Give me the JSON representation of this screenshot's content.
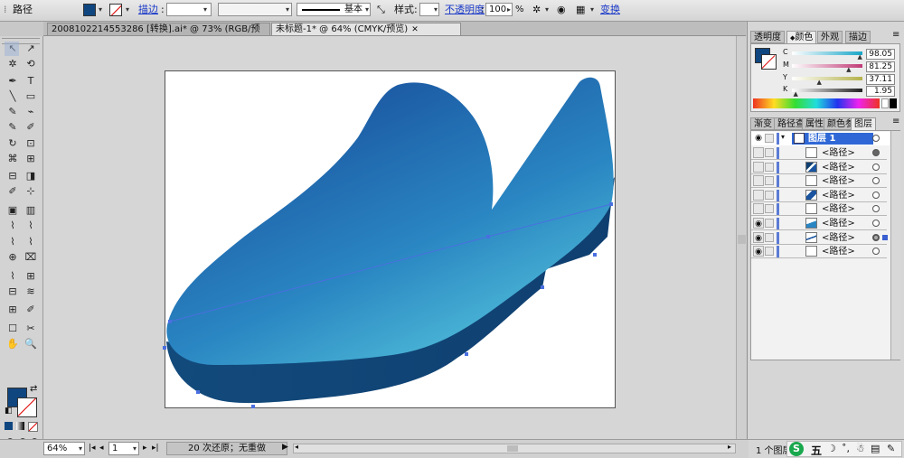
{
  "control_bar": {
    "selection_label": "路径",
    "fill_color": "#0f4680",
    "stroke_label": "描边",
    "stroke_weight": "",
    "brush_label": "基本",
    "style_label": "样式",
    "opacity_label": "不透明度",
    "opacity_value": "100",
    "opacity_unit": "%",
    "transform_label": "变换"
  },
  "tabs": [
    {
      "label": "2008102214553286 [转换].ai* @ 73% (RGB/预览)",
      "close": "✕"
    },
    {
      "label": "未标题-1* @ 64% (CMYK/预览)",
      "close": "✕"
    }
  ],
  "tools": [
    "↖",
    "↗",
    "✲",
    "⟲",
    "✒",
    "T",
    "╲",
    "▭",
    "✎",
    "⌁",
    "✎",
    "✐",
    "↻",
    "⊡",
    "⌘",
    "⊞",
    "⊟",
    "◨",
    "✐",
    "⊹",
    "▣",
    "▥",
    "⌇",
    "⌇",
    "⌇",
    "⌇",
    "⊕",
    "⌧",
    "⌇",
    "⊞",
    "⊟",
    "≋",
    "⊞",
    "✐",
    "☐",
    "✂",
    "✋",
    "🔍"
  ],
  "color_panel": {
    "tabs": [
      "透明度",
      "颜色",
      "外观",
      "描边"
    ],
    "active_tab": "颜色",
    "channels": [
      {
        "name": "C",
        "value": "98.05",
        "color": "#19a6c8"
      },
      {
        "name": "M",
        "value": "81.25",
        "color": "#c03a76"
      },
      {
        "name": "Y",
        "value": "37.11",
        "color": "#b4b24a"
      },
      {
        "name": "K",
        "value": "1.95",
        "color": "#202020"
      }
    ]
  },
  "layers_panel": {
    "tabs": [
      "渐变",
      "路径查",
      "属性",
      "颜色参",
      "图层"
    ],
    "active_tab": "图层",
    "parent_layer": "图层 1",
    "items": [
      {
        "label": "<路径>",
        "eye": false,
        "thumb": "blank"
      },
      {
        "label": "<路径>",
        "eye": false,
        "thumb": "dark"
      },
      {
        "label": "<路径>",
        "eye": false,
        "thumb": "blank"
      },
      {
        "label": "<路径>",
        "eye": false,
        "thumb": "shape"
      },
      {
        "label": "<路径>",
        "eye": false,
        "thumb": "blank"
      },
      {
        "label": "<路径>",
        "eye": true,
        "thumb": "shape2"
      },
      {
        "label": "<路径>",
        "eye": true,
        "thumb": "line"
      },
      {
        "label": "<路径>",
        "eye": true,
        "thumb": "blank"
      }
    ],
    "footer_count": "1 个图层"
  },
  "status_bar": {
    "zoom": "64%",
    "page": "1",
    "undo_text": "20 次还原；无重做"
  },
  "taskbar": {
    "ime_char": "五"
  },
  "colors": {
    "shoe_dark": "#0f3f70",
    "shoe_mid": "#1a67ab",
    "shoe_light": "#4fbfd8",
    "selection_blue": "#4a6fe0"
  }
}
